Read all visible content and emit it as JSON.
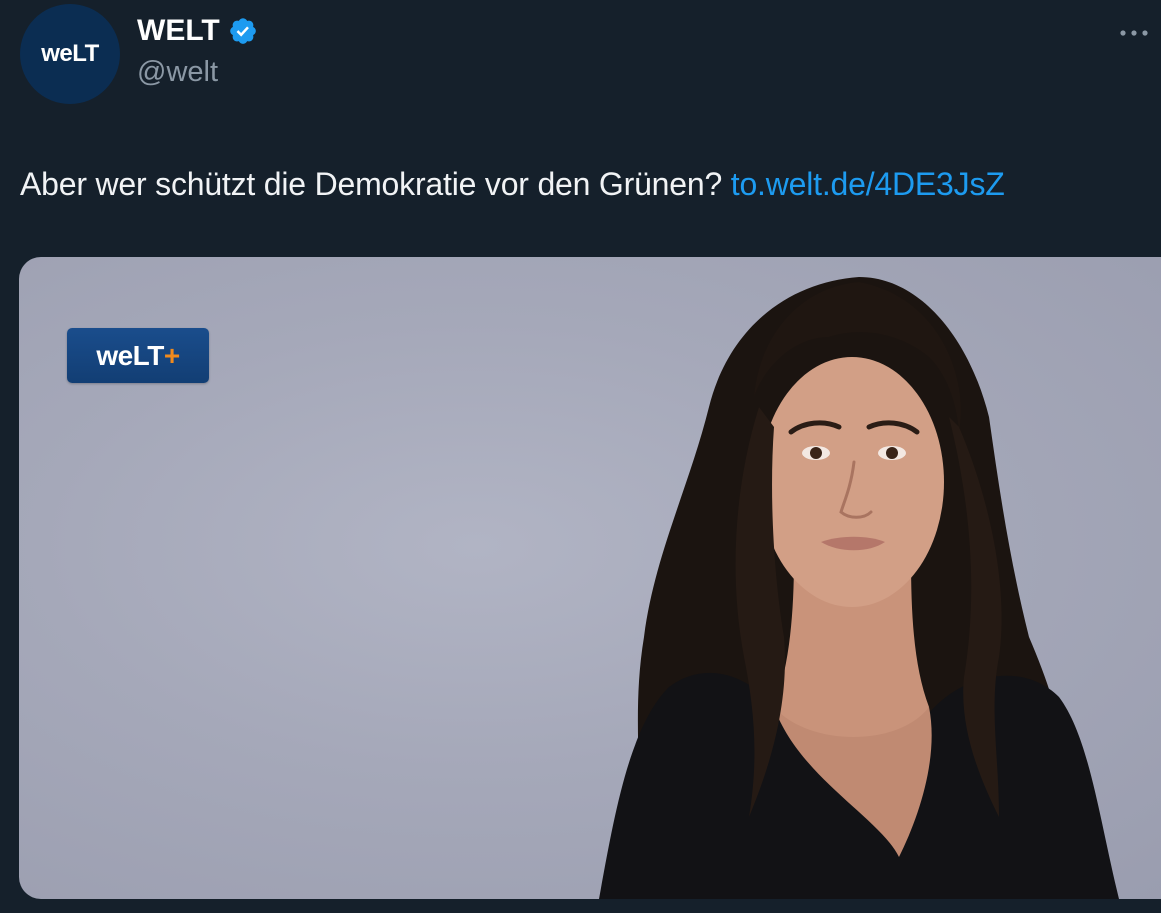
{
  "account": {
    "display_name": "WELT",
    "handle": "@welt",
    "avatar_text": "weLT",
    "verified": true
  },
  "tweet": {
    "text": "Aber wer schützt die Demokratie vor den Grünen? ",
    "link_text": "to.welt.de/4DE3JsZ"
  },
  "media": {
    "badge_text": "weLT",
    "badge_plus": "+"
  },
  "icons": {
    "verified": "verified-badge-icon",
    "more": "more-options-icon"
  },
  "colors": {
    "background": "#15202b",
    "link": "#1d9bf0",
    "verified": "#1d9bf0",
    "handle": "#8b98a5",
    "brand_blue": "#0b2d52",
    "badge_plus": "#f08a1d"
  }
}
